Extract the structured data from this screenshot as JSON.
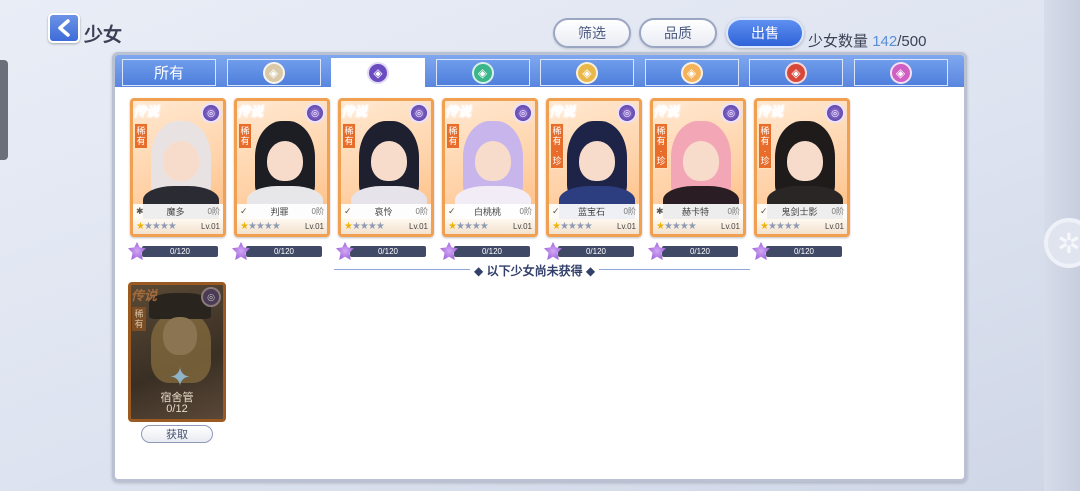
{
  "header": {
    "title": "少女",
    "buttons": {
      "filter": "筛选",
      "quality": "品质",
      "sell": "出售"
    },
    "count_label": "少女数量",
    "count_current": "142",
    "count_total": "/500"
  },
  "tabs": [
    {
      "label": "所有",
      "icon": "",
      "color": ""
    },
    {
      "label": "",
      "icon": "shield-element-icon",
      "color": "#d9c9a8"
    },
    {
      "label": "",
      "icon": "dark-element-icon",
      "color": "#6a4cc0"
    },
    {
      "label": "",
      "icon": "wind-element-icon",
      "color": "#3bb58a"
    },
    {
      "label": "",
      "icon": "star-element-icon",
      "color": "#e9b84a"
    },
    {
      "label": "",
      "icon": "light-element-icon",
      "color": "#f4b25a"
    },
    {
      "label": "",
      "icon": "fire-element-icon",
      "color": "#d8483a"
    },
    {
      "label": "",
      "icon": "magic-element-icon",
      "color": "#d05fc4"
    }
  ],
  "cards": [
    {
      "legend": "传说",
      "rarity": "稀有",
      "name": "魔多",
      "role": "✱",
      "tier": "0阶",
      "level": "Lv.01",
      "progress": "0/120",
      "hair": "#e9e2e2",
      "outfit": "#2b2b33"
    },
    {
      "legend": "传说",
      "rarity": "稀有",
      "name": "判罪",
      "role": "✓",
      "tier": "0阶",
      "level": "Lv.01",
      "progress": "0/120",
      "hair": "#1d1d24",
      "outfit": "#e7e7ea"
    },
    {
      "legend": "传说",
      "rarity": "稀有",
      "name": "哀怜",
      "role": "✓",
      "tier": "0阶",
      "level": "Lv.01",
      "progress": "0/120",
      "hair": "#1e2030",
      "outfit": "#e7e3ea"
    },
    {
      "legend": "传说",
      "rarity": "稀有",
      "name": "白桃桃",
      "role": "✓",
      "tier": "0阶",
      "level": "Lv.01",
      "progress": "0/120",
      "hair": "#c8b5ec",
      "outfit": "#f1ecf6"
    },
    {
      "legend": "传说",
      "rarity": "稀有·珍",
      "name": "蓝宝石",
      "role": "✓",
      "tier": "0阶",
      "level": "Lv.01",
      "progress": "0/120",
      "hair": "#1d2448",
      "outfit": "#2c3e80"
    },
    {
      "legend": "传说",
      "rarity": "稀有·珍",
      "name": "赫卡特",
      "role": "✱",
      "tier": "0阶",
      "level": "Lv.01",
      "progress": "0/120",
      "hair": "#f3a6b5",
      "outfit": "#2a1d24"
    },
    {
      "legend": "传说",
      "rarity": "稀有·珍",
      "name": "鬼剑士影",
      "role": "✓",
      "tier": "0阶",
      "level": "Lv.01",
      "progress": "0/120",
      "hair": "#1f1b1b",
      "outfit": "#2b2626"
    }
  ],
  "divider_label": "◆ 以下少女尚未获得 ◆",
  "locked_card": {
    "legend": "传说",
    "rarity": "稀有",
    "name": "宿舍管",
    "progress": "0/12",
    "obtain_label": "获取"
  }
}
